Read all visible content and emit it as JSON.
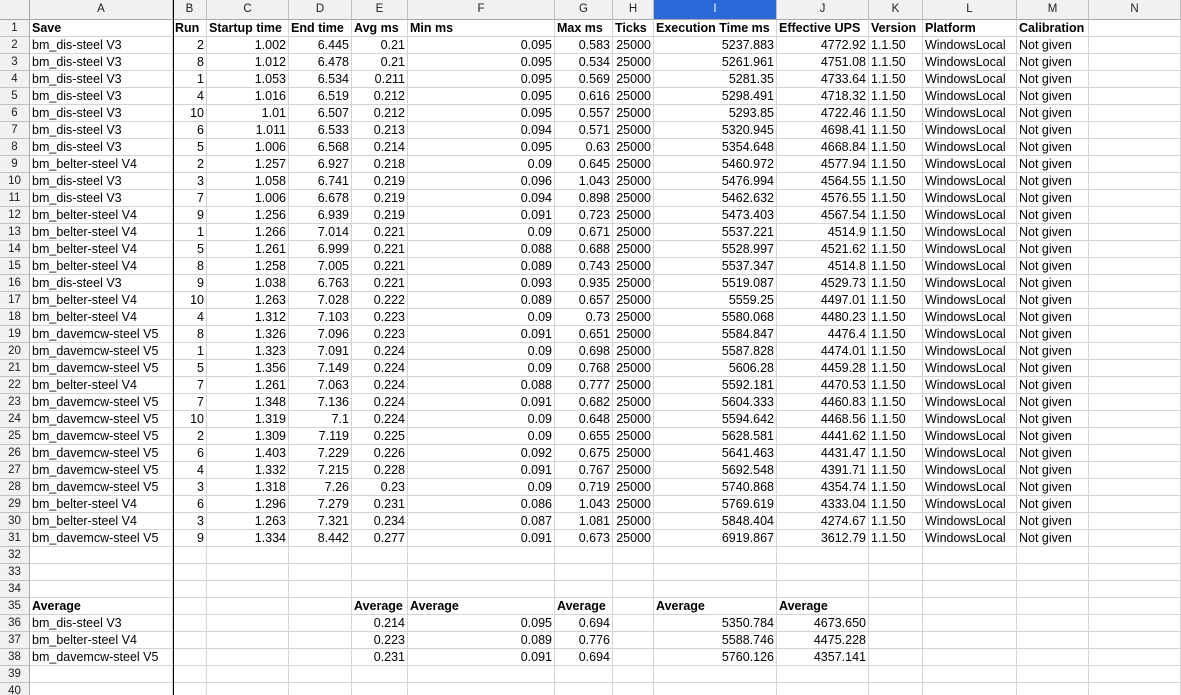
{
  "columns": [
    {
      "letter": "A",
      "header": "Save"
    },
    {
      "letter": "B",
      "header": "Run"
    },
    {
      "letter": "C",
      "header": "Startup time"
    },
    {
      "letter": "D",
      "header": "End time"
    },
    {
      "letter": "E",
      "header": "Avg ms"
    },
    {
      "letter": "F",
      "header": "Min ms"
    },
    {
      "letter": "G",
      "header": "Max ms"
    },
    {
      "letter": "H",
      "header": "Ticks"
    },
    {
      "letter": "I",
      "header": "Execution Time ms"
    },
    {
      "letter": "J",
      "header": "Effective UPS"
    },
    {
      "letter": "K",
      "header": "Version"
    },
    {
      "letter": "L",
      "header": "Platform"
    },
    {
      "letter": "M",
      "header": "Calibration"
    },
    {
      "letter": "N",
      "header": ""
    }
  ],
  "selected_column": "I",
  "data_rows": [
    [
      "bm_dis-steel V3",
      "2",
      "1.002",
      "6.445",
      "0.21",
      "0.095",
      "0.583",
      "25000",
      "5237.883",
      "4772.92",
      "1.1.50",
      "WindowsLocal",
      "Not given"
    ],
    [
      "bm_dis-steel V3",
      "8",
      "1.012",
      "6.478",
      "0.21",
      "0.095",
      "0.534",
      "25000",
      "5261.961",
      "4751.08",
      "1.1.50",
      "WindowsLocal",
      "Not given"
    ],
    [
      "bm_dis-steel V3",
      "1",
      "1.053",
      "6.534",
      "0.211",
      "0.095",
      "0.569",
      "25000",
      "5281.35",
      "4733.64",
      "1.1.50",
      "WindowsLocal",
      "Not given"
    ],
    [
      "bm_dis-steel V3",
      "4",
      "1.016",
      "6.519",
      "0.212",
      "0.095",
      "0.616",
      "25000",
      "5298.491",
      "4718.32",
      "1.1.50",
      "WindowsLocal",
      "Not given"
    ],
    [
      "bm_dis-steel V3",
      "10",
      "1.01",
      "6.507",
      "0.212",
      "0.095",
      "0.557",
      "25000",
      "5293.85",
      "4722.46",
      "1.1.50",
      "WindowsLocal",
      "Not given"
    ],
    [
      "bm_dis-steel V3",
      "6",
      "1.011",
      "6.533",
      "0.213",
      "0.094",
      "0.571",
      "25000",
      "5320.945",
      "4698.41",
      "1.1.50",
      "WindowsLocal",
      "Not given"
    ],
    [
      "bm_dis-steel V3",
      "5",
      "1.006",
      "6.568",
      "0.214",
      "0.095",
      "0.63",
      "25000",
      "5354.648",
      "4668.84",
      "1.1.50",
      "WindowsLocal",
      "Not given"
    ],
    [
      "bm_belter-steel V4",
      "2",
      "1.257",
      "6.927",
      "0.218",
      "0.09",
      "0.645",
      "25000",
      "5460.972",
      "4577.94",
      "1.1.50",
      "WindowsLocal",
      "Not given"
    ],
    [
      "bm_dis-steel V3",
      "3",
      "1.058",
      "6.741",
      "0.219",
      "0.096",
      "1.043",
      "25000",
      "5476.994",
      "4564.55",
      "1.1.50",
      "WindowsLocal",
      "Not given"
    ],
    [
      "bm_dis-steel V3",
      "7",
      "1.006",
      "6.678",
      "0.219",
      "0.094",
      "0.898",
      "25000",
      "5462.632",
      "4576.55",
      "1.1.50",
      "WindowsLocal",
      "Not given"
    ],
    [
      "bm_belter-steel V4",
      "9",
      "1.256",
      "6.939",
      "0.219",
      "0.091",
      "0.723",
      "25000",
      "5473.403",
      "4567.54",
      "1.1.50",
      "WindowsLocal",
      "Not given"
    ],
    [
      "bm_belter-steel V4",
      "1",
      "1.266",
      "7.014",
      "0.221",
      "0.09",
      "0.671",
      "25000",
      "5537.221",
      "4514.9",
      "1.1.50",
      "WindowsLocal",
      "Not given"
    ],
    [
      "bm_belter-steel V4",
      "5",
      "1.261",
      "6.999",
      "0.221",
      "0.088",
      "0.688",
      "25000",
      "5528.997",
      "4521.62",
      "1.1.50",
      "WindowsLocal",
      "Not given"
    ],
    [
      "bm_belter-steel V4",
      "8",
      "1.258",
      "7.005",
      "0.221",
      "0.089",
      "0.743",
      "25000",
      "5537.347",
      "4514.8",
      "1.1.50",
      "WindowsLocal",
      "Not given"
    ],
    [
      "bm_dis-steel V3",
      "9",
      "1.038",
      "6.763",
      "0.221",
      "0.093",
      "0.935",
      "25000",
      "5519.087",
      "4529.73",
      "1.1.50",
      "WindowsLocal",
      "Not given"
    ],
    [
      "bm_belter-steel V4",
      "10",
      "1.263",
      "7.028",
      "0.222",
      "0.089",
      "0.657",
      "25000",
      "5559.25",
      "4497.01",
      "1.1.50",
      "WindowsLocal",
      "Not given"
    ],
    [
      "bm_belter-steel V4",
      "4",
      "1.312",
      "7.103",
      "0.223",
      "0.09",
      "0.73",
      "25000",
      "5580.068",
      "4480.23",
      "1.1.50",
      "WindowsLocal",
      "Not given"
    ],
    [
      "bm_davemcw-steel V5",
      "8",
      "1.326",
      "7.096",
      "0.223",
      "0.091",
      "0.651",
      "25000",
      "5584.847",
      "4476.4",
      "1.1.50",
      "WindowsLocal",
      "Not given"
    ],
    [
      "bm_davemcw-steel V5",
      "1",
      "1.323",
      "7.091",
      "0.224",
      "0.09",
      "0.698",
      "25000",
      "5587.828",
      "4474.01",
      "1.1.50",
      "WindowsLocal",
      "Not given"
    ],
    [
      "bm_davemcw-steel V5",
      "5",
      "1.356",
      "7.149",
      "0.224",
      "0.09",
      "0.768",
      "25000",
      "5606.28",
      "4459.28",
      "1.1.50",
      "WindowsLocal",
      "Not given"
    ],
    [
      "bm_belter-steel V4",
      "7",
      "1.261",
      "7.063",
      "0.224",
      "0.088",
      "0.777",
      "25000",
      "5592.181",
      "4470.53",
      "1.1.50",
      "WindowsLocal",
      "Not given"
    ],
    [
      "bm_davemcw-steel V5",
      "7",
      "1.348",
      "7.136",
      "0.224",
      "0.091",
      "0.682",
      "25000",
      "5604.333",
      "4460.83",
      "1.1.50",
      "WindowsLocal",
      "Not given"
    ],
    [
      "bm_davemcw-steel V5",
      "10",
      "1.319",
      "7.1",
      "0.224",
      "0.09",
      "0.648",
      "25000",
      "5594.642",
      "4468.56",
      "1.1.50",
      "WindowsLocal",
      "Not given"
    ],
    [
      "bm_davemcw-steel V5",
      "2",
      "1.309",
      "7.119",
      "0.225",
      "0.09",
      "0.655",
      "25000",
      "5628.581",
      "4441.62",
      "1.1.50",
      "WindowsLocal",
      "Not given"
    ],
    [
      "bm_davemcw-steel V5",
      "6",
      "1.403",
      "7.229",
      "0.226",
      "0.092",
      "0.675",
      "25000",
      "5641.463",
      "4431.47",
      "1.1.50",
      "WindowsLocal",
      "Not given"
    ],
    [
      "bm_davemcw-steel V5",
      "4",
      "1.332",
      "7.215",
      "0.228",
      "0.091",
      "0.767",
      "25000",
      "5692.548",
      "4391.71",
      "1.1.50",
      "WindowsLocal",
      "Not given"
    ],
    [
      "bm_davemcw-steel V5",
      "3",
      "1.318",
      "7.26",
      "0.23",
      "0.09",
      "0.719",
      "25000",
      "5740.868",
      "4354.74",
      "1.1.50",
      "WindowsLocal",
      "Not given"
    ],
    [
      "bm_belter-steel V4",
      "6",
      "1.296",
      "7.279",
      "0.231",
      "0.086",
      "1.043",
      "25000",
      "5769.619",
      "4333.04",
      "1.1.50",
      "WindowsLocal",
      "Not given"
    ],
    [
      "bm_belter-steel V4",
      "3",
      "1.263",
      "7.321",
      "0.234",
      "0.087",
      "1.081",
      "25000",
      "5848.404",
      "4274.67",
      "1.1.50",
      "WindowsLocal",
      "Not given"
    ],
    [
      "bm_davemcw-steel V5",
      "9",
      "1.334",
      "8.442",
      "0.277",
      "0.091",
      "0.673",
      "25000",
      "6919.867",
      "3612.79",
      "1.1.50",
      "WindowsLocal",
      "Not given"
    ]
  ],
  "average_header": {
    "save": "Average",
    "avg_ms": "Average",
    "min_ms": "Average",
    "max_ms": "Average",
    "exec_time": "Average",
    "ups": "Average"
  },
  "average_rows": [
    {
      "save": "bm_dis-steel V3",
      "avg_ms": "0.214",
      "min_ms": "0.095",
      "max_ms": "0.694",
      "exec_time": "5350.784",
      "ups": "4673.650"
    },
    {
      "save": "bm_belter-steel V4",
      "avg_ms": "0.223",
      "min_ms": "0.089",
      "max_ms": "0.776",
      "exec_time": "5588.746",
      "ups": "4475.228"
    },
    {
      "save": "bm_davemcw-steel V5",
      "avg_ms": "0.231",
      "min_ms": "0.091",
      "max_ms": "0.694",
      "exec_time": "5760.126",
      "ups": "4357.141"
    }
  ],
  "row_numbers": [
    "1",
    "2",
    "3",
    "4",
    "5",
    "6",
    "7",
    "8",
    "9",
    "10",
    "11",
    "12",
    "13",
    "14",
    "15",
    "16",
    "17",
    "18",
    "19",
    "20",
    "21",
    "22",
    "23",
    "24",
    "25",
    "26",
    "27",
    "28",
    "29",
    "30",
    "31",
    "32",
    "33",
    "34",
    "35",
    "36",
    "37",
    "38",
    "39",
    "40"
  ]
}
